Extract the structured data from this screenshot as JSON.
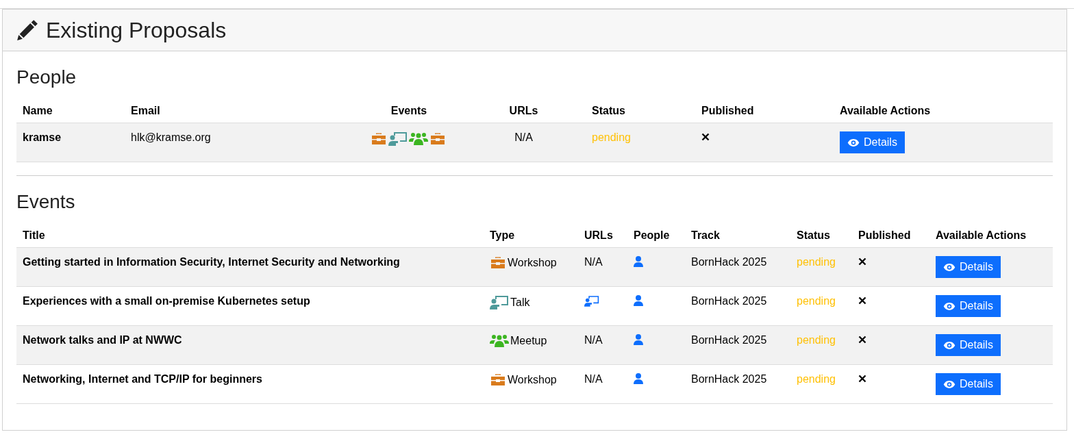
{
  "panel": {
    "title": "Existing Proposals"
  },
  "people": {
    "heading": "People",
    "columns": [
      "Name",
      "Email",
      "Events",
      "URLs",
      "Status",
      "Published",
      "Available Actions"
    ],
    "rows": [
      {
        "name": "kramse",
        "email": "hlk@kramse.org",
        "events": [
          {
            "kind": "workshop"
          },
          {
            "kind": "talk"
          },
          {
            "kind": "meetup"
          },
          {
            "kind": "workshop"
          }
        ],
        "urls": "N/A",
        "status": "pending",
        "published": false,
        "action": "Details"
      }
    ]
  },
  "events": {
    "heading": "Events",
    "columns": [
      "Title",
      "Type",
      "URLs",
      "People",
      "Track",
      "Status",
      "Published",
      "Available Actions"
    ],
    "rows": [
      {
        "title": "Getting started in Information Security, Internet Security and Networking",
        "type": {
          "kind": "workshop",
          "label": "Workshop"
        },
        "urls": {
          "kind": "text",
          "text": "N/A"
        },
        "track": "BornHack 2025",
        "status": "pending",
        "published": false,
        "action": "Details"
      },
      {
        "title": "Experiences with a small on-premise Kubernetes setup",
        "type": {
          "kind": "talk",
          "label": "Talk"
        },
        "urls": {
          "kind": "slides"
        },
        "track": "BornHack 2025",
        "status": "pending",
        "published": false,
        "action": "Details"
      },
      {
        "title": "Network talks and IP at NWWC",
        "type": {
          "kind": "meetup",
          "label": "Meetup"
        },
        "urls": {
          "kind": "text",
          "text": "N/A"
        },
        "track": "BornHack 2025",
        "status": "pending",
        "published": false,
        "action": "Details"
      },
      {
        "title": "Networking, Internet and TCP/IP for beginners",
        "type": {
          "kind": "workshop",
          "label": "Workshop"
        },
        "urls": {
          "kind": "text",
          "text": "N/A"
        },
        "track": "BornHack 2025",
        "status": "pending",
        "published": false,
        "action": "Details"
      }
    ]
  }
}
